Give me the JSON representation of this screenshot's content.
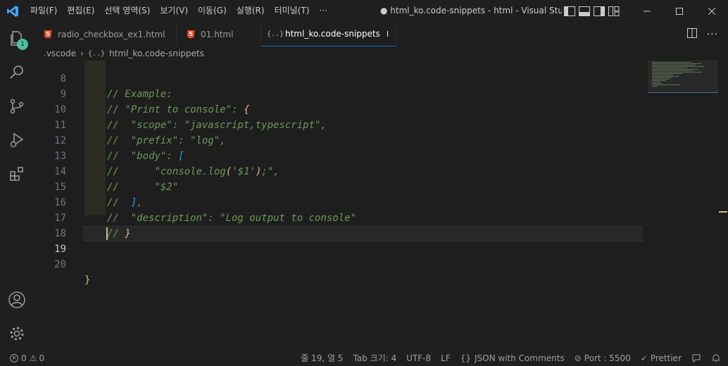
{
  "titlebar": {
    "menu": [
      "파일(F)",
      "편집(E)",
      "선택 영역(S)",
      "보기(V)",
      "이동(G)",
      "실행(R)",
      "터미널(T)",
      "···"
    ],
    "window_title": "● html_ko.code-snippets - html - Visual Studio Code"
  },
  "activity": {
    "explorer_badge": "1",
    "icons": [
      "files-icon",
      "search-icon",
      "source-control-icon",
      "run-debug-icon",
      "extensions-icon",
      "account-icon",
      "settings-gear-icon"
    ]
  },
  "tabs": [
    {
      "label": "radio_checkbox_ex1.html",
      "icon": "html5-icon",
      "active": false
    },
    {
      "label": "01.html",
      "icon": "html5-icon",
      "active": false
    },
    {
      "label": "html_ko.code-snippets",
      "icon": "json-braces-icon",
      "active": true,
      "dirty": true
    }
  ],
  "breadcrumb": {
    "folder": ".vscode",
    "file": "html_ko.code-snippets",
    "file_icon": "{..}"
  },
  "editor": {
    "lines": [
      {
        "num": "8",
        "text": "// Example:"
      },
      {
        "num": "9",
        "text": "// \"Print to console\": {"
      },
      {
        "num": "10",
        "text": "//  \"scope\": \"javascript,typescript\","
      },
      {
        "num": "11",
        "text": "//  \"prefix\": \"log\","
      },
      {
        "num": "12",
        "text": "//  \"body\": ["
      },
      {
        "num": "13",
        "text": "//      \"console.log('$1');\","
      },
      {
        "num": "14",
        "text": "//      \"$2\""
      },
      {
        "num": "15",
        "text": "//  ],"
      },
      {
        "num": "16",
        "text": "//  \"description\": \"Log output to console\""
      },
      {
        "num": "17",
        "text": "// }"
      },
      {
        "num": "18",
        "text": ""
      },
      {
        "num": "19",
        "text": ""
      },
      {
        "num": "20",
        "text": "}"
      }
    ],
    "current_line": "19"
  },
  "statusbar": {
    "errors": "0",
    "warnings": "0",
    "position": "줄 19, 열 5",
    "tab_size": "Tab 크기: 4",
    "encoding": "UTF-8",
    "eol": "LF",
    "language": "JSON with Comments",
    "port": "Port : 5500",
    "prettier": "Prettier"
  },
  "colors": {
    "accent": "#0078d4",
    "comment": "#6a9955",
    "badge": "#4dc1a1",
    "bracket_yellow": "#d7ba7d",
    "bracket_blue": "#179fff"
  }
}
